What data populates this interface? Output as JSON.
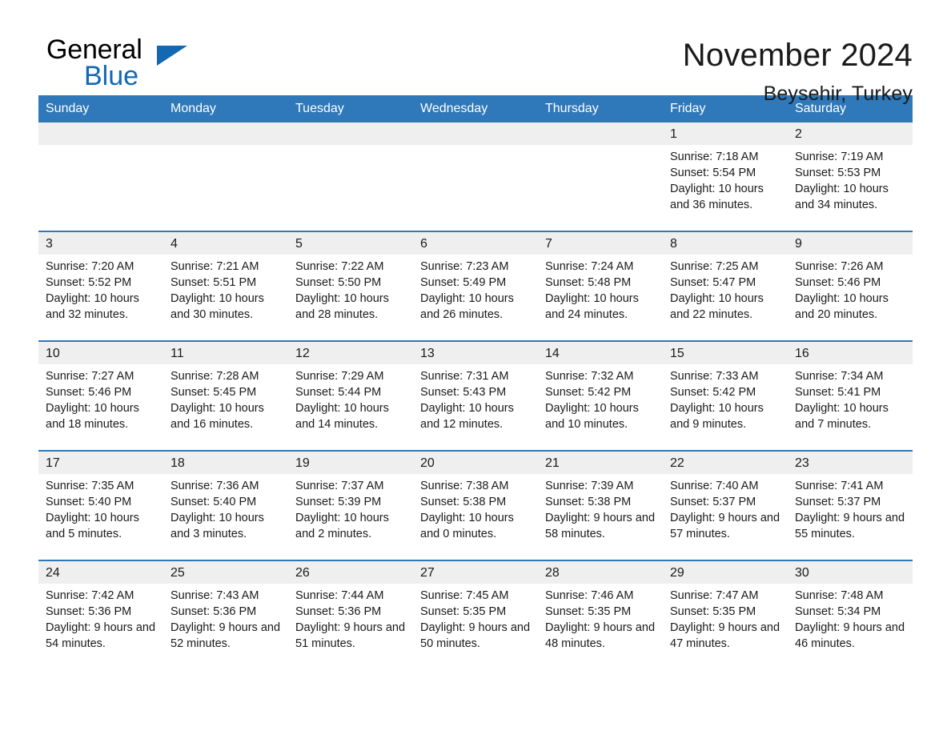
{
  "brand": {
    "name_top": "General",
    "name_bottom": "Blue",
    "accent_color": "#1268b3"
  },
  "header": {
    "month_title": "November 2024",
    "location": "Beysehir, Turkey"
  },
  "calendar": {
    "header_color": "#2f78b9",
    "daynum_band_color": "#efefef",
    "weekday_headers": [
      "Sunday",
      "Monday",
      "Tuesday",
      "Wednesday",
      "Thursday",
      "Friday",
      "Saturday"
    ],
    "weeks": [
      [
        {
          "day": "",
          "empty": true
        },
        {
          "day": "",
          "empty": true
        },
        {
          "day": "",
          "empty": true
        },
        {
          "day": "",
          "empty": true
        },
        {
          "day": "",
          "empty": true
        },
        {
          "day": "1",
          "sunrise": "Sunrise: 7:18 AM",
          "sunset": "Sunset: 5:54 PM",
          "daylight": "Daylight: 10 hours and 36 minutes."
        },
        {
          "day": "2",
          "sunrise": "Sunrise: 7:19 AM",
          "sunset": "Sunset: 5:53 PM",
          "daylight": "Daylight: 10 hours and 34 minutes."
        }
      ],
      [
        {
          "day": "3",
          "sunrise": "Sunrise: 7:20 AM",
          "sunset": "Sunset: 5:52 PM",
          "daylight": "Daylight: 10 hours and 32 minutes."
        },
        {
          "day": "4",
          "sunrise": "Sunrise: 7:21 AM",
          "sunset": "Sunset: 5:51 PM",
          "daylight": "Daylight: 10 hours and 30 minutes."
        },
        {
          "day": "5",
          "sunrise": "Sunrise: 7:22 AM",
          "sunset": "Sunset: 5:50 PM",
          "daylight": "Daylight: 10 hours and 28 minutes."
        },
        {
          "day": "6",
          "sunrise": "Sunrise: 7:23 AM",
          "sunset": "Sunset: 5:49 PM",
          "daylight": "Daylight: 10 hours and 26 minutes."
        },
        {
          "day": "7",
          "sunrise": "Sunrise: 7:24 AM",
          "sunset": "Sunset: 5:48 PM",
          "daylight": "Daylight: 10 hours and 24 minutes."
        },
        {
          "day": "8",
          "sunrise": "Sunrise: 7:25 AM",
          "sunset": "Sunset: 5:47 PM",
          "daylight": "Daylight: 10 hours and 22 minutes."
        },
        {
          "day": "9",
          "sunrise": "Sunrise: 7:26 AM",
          "sunset": "Sunset: 5:46 PM",
          "daylight": "Daylight: 10 hours and 20 minutes."
        }
      ],
      [
        {
          "day": "10",
          "sunrise": "Sunrise: 7:27 AM",
          "sunset": "Sunset: 5:46 PM",
          "daylight": "Daylight: 10 hours and 18 minutes."
        },
        {
          "day": "11",
          "sunrise": "Sunrise: 7:28 AM",
          "sunset": "Sunset: 5:45 PM",
          "daylight": "Daylight: 10 hours and 16 minutes."
        },
        {
          "day": "12",
          "sunrise": "Sunrise: 7:29 AM",
          "sunset": "Sunset: 5:44 PM",
          "daylight": "Daylight: 10 hours and 14 minutes."
        },
        {
          "day": "13",
          "sunrise": "Sunrise: 7:31 AM",
          "sunset": "Sunset: 5:43 PM",
          "daylight": "Daylight: 10 hours and 12 minutes."
        },
        {
          "day": "14",
          "sunrise": "Sunrise: 7:32 AM",
          "sunset": "Sunset: 5:42 PM",
          "daylight": "Daylight: 10 hours and 10 minutes."
        },
        {
          "day": "15",
          "sunrise": "Sunrise: 7:33 AM",
          "sunset": "Sunset: 5:42 PM",
          "daylight": "Daylight: 10 hours and 9 minutes."
        },
        {
          "day": "16",
          "sunrise": "Sunrise: 7:34 AM",
          "sunset": "Sunset: 5:41 PM",
          "daylight": "Daylight: 10 hours and 7 minutes."
        }
      ],
      [
        {
          "day": "17",
          "sunrise": "Sunrise: 7:35 AM",
          "sunset": "Sunset: 5:40 PM",
          "daylight": "Daylight: 10 hours and 5 minutes."
        },
        {
          "day": "18",
          "sunrise": "Sunrise: 7:36 AM",
          "sunset": "Sunset: 5:40 PM",
          "daylight": "Daylight: 10 hours and 3 minutes."
        },
        {
          "day": "19",
          "sunrise": "Sunrise: 7:37 AM",
          "sunset": "Sunset: 5:39 PM",
          "daylight": "Daylight: 10 hours and 2 minutes."
        },
        {
          "day": "20",
          "sunrise": "Sunrise: 7:38 AM",
          "sunset": "Sunset: 5:38 PM",
          "daylight": "Daylight: 10 hours and 0 minutes."
        },
        {
          "day": "21",
          "sunrise": "Sunrise: 7:39 AM",
          "sunset": "Sunset: 5:38 PM",
          "daylight": "Daylight: 9 hours and 58 minutes."
        },
        {
          "day": "22",
          "sunrise": "Sunrise: 7:40 AM",
          "sunset": "Sunset: 5:37 PM",
          "daylight": "Daylight: 9 hours and 57 minutes."
        },
        {
          "day": "23",
          "sunrise": "Sunrise: 7:41 AM",
          "sunset": "Sunset: 5:37 PM",
          "daylight": "Daylight: 9 hours and 55 minutes."
        }
      ],
      [
        {
          "day": "24",
          "sunrise": "Sunrise: 7:42 AM",
          "sunset": "Sunset: 5:36 PM",
          "daylight": "Daylight: 9 hours and 54 minutes."
        },
        {
          "day": "25",
          "sunrise": "Sunrise: 7:43 AM",
          "sunset": "Sunset: 5:36 PM",
          "daylight": "Daylight: 9 hours and 52 minutes."
        },
        {
          "day": "26",
          "sunrise": "Sunrise: 7:44 AM",
          "sunset": "Sunset: 5:36 PM",
          "daylight": "Daylight: 9 hours and 51 minutes."
        },
        {
          "day": "27",
          "sunrise": "Sunrise: 7:45 AM",
          "sunset": "Sunset: 5:35 PM",
          "daylight": "Daylight: 9 hours and 50 minutes."
        },
        {
          "day": "28",
          "sunrise": "Sunrise: 7:46 AM",
          "sunset": "Sunset: 5:35 PM",
          "daylight": "Daylight: 9 hours and 48 minutes."
        },
        {
          "day": "29",
          "sunrise": "Sunrise: 7:47 AM",
          "sunset": "Sunset: 5:35 PM",
          "daylight": "Daylight: 9 hours and 47 minutes."
        },
        {
          "day": "30",
          "sunrise": "Sunrise: 7:48 AM",
          "sunset": "Sunset: 5:34 PM",
          "daylight": "Daylight: 9 hours and 46 minutes."
        }
      ]
    ]
  }
}
